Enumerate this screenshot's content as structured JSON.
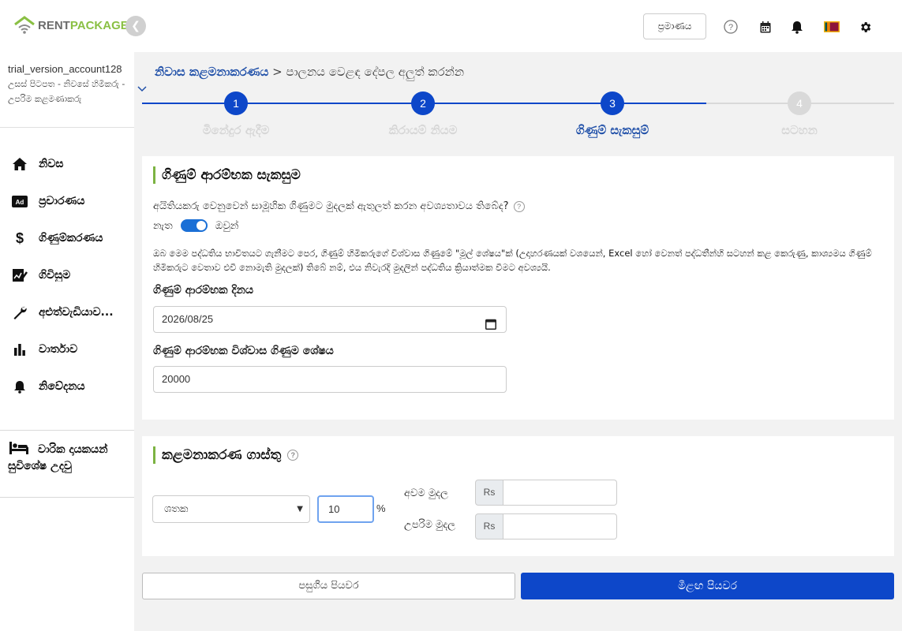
{
  "brand": {
    "rent": "RENT",
    "package": "PACKAGE",
    "accent": "#8ac044"
  },
  "header": {
    "pramana_label": "ප්‍රමාණය",
    "flag": "🇱🇰"
  },
  "sidebar": {
    "account_name": "trial_version_account128",
    "account_role": "උසස් පිටපත - නිවසේ හිමිකරු - උපරිම කළමණාකරු",
    "items": [
      {
        "label": "නිවස",
        "icon": "home-icon"
      },
      {
        "label": "ප්‍රචාරණය",
        "icon": "ad-icon"
      },
      {
        "label": "ගිණුම්කරණය",
        "icon": "dollar-icon"
      },
      {
        "label": "ගිවිසුම",
        "icon": "contract-icon"
      },
      {
        "label": "අළුත්වැඩියාව...",
        "icon": "wrench-icon"
      },
      {
        "label": "වාර්තාව",
        "icon": "bar-chart-icon"
      },
      {
        "label": "නිවේදනය",
        "icon": "bell-icon"
      }
    ],
    "vip_label": "වාරික දායකයන් සුවිශේෂ උදවු"
  },
  "breadcrumb": {
    "link": "නිවාස කළමනාකරණය",
    "sep": " > ",
    "current": "පාලනය වෙළඳ දේපල අලුත් කරන්න"
  },
  "stepper": {
    "steps": [
      {
        "num": "1",
        "label": "මිනේදුර ඇදීම"
      },
      {
        "num": "2",
        "label": "කිරායම් නියම"
      },
      {
        "num": "3",
        "label": "ගිණුම් සැකසුම්"
      },
      {
        "num": "4",
        "label": "සටහන"
      }
    ],
    "active_step": 3,
    "active_color": "#0d47c9",
    "inactive_color": "#d9d9d9"
  },
  "accounting": {
    "title": "ගිණුම් ආරම්භක සැකසුම",
    "question": "අයිතියකරු වෙනුවෙන් සාමූහික ගිණුමට මුදලක් ඇතුලත් කරන අවශ්‍යතාවය තිබේද?",
    "toggle_no": "නැත",
    "toggle_yes": "ඔවුන්",
    "toggle_on": true,
    "info": "ඔබ මෙම පද්ධතිය භාවිතයට ගැනීමට පෙර, ගිණුම් හිමිකරුගේ විශ්වාස ගිණුමේ \"මූල් ශේෂය\"ක් (උදාහරණයක් වශයෙන්, Excel හෝ වෙනත් පද්ධතීන්හි සටහන් කළ කෙරුණු, කාශ්‍යමය ගිණුම් හිමිකරුට වෙතාව එවී නොමැති මුදලක්) තිබේ නම්, එය නිවැරදි මුදලින් පද්ධතිය ක්‍රියාත්මක වීමට අවශ්‍යයි.",
    "start_date_label": "ගිණුම් ආරම්භක දිනය",
    "start_date_value": "2026/08/25",
    "balance_label": "ගිණුම් ආරම්භක විශ්වාස ගිණුම ශේෂය",
    "balance_value": "20000"
  },
  "fees": {
    "title": "කළමනාකරණ ගාස්තු",
    "type_selected": "ශතක",
    "percent_value": "10",
    "percent_sign": "%",
    "min_label": "අවම මුදල",
    "max_label": "උපරිම මුදල",
    "currency": "Rs"
  },
  "buttons": {
    "back": "පසුගිය පියවර",
    "next": "මීළඟ පියවර"
  }
}
